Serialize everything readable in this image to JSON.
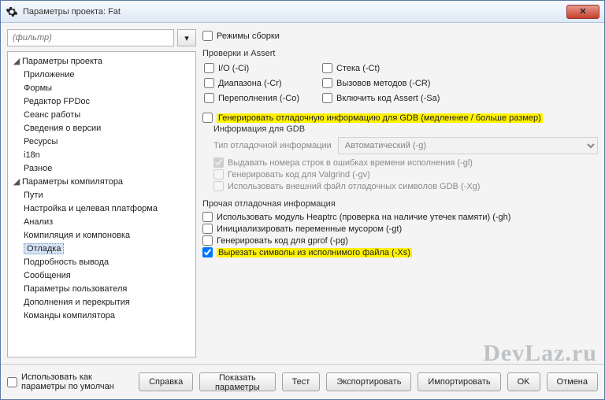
{
  "window": {
    "title": "Параметры проекта: Fat",
    "close": "✕"
  },
  "filter": {
    "placeholder": "(фильтр)"
  },
  "tree": {
    "root1": "Параметры проекта",
    "r1": [
      "Приложение",
      "Формы",
      "Редактор FPDoc",
      "Сеанс работы",
      "Сведения о версии",
      "Ресурсы",
      "i18n",
      "Разное"
    ],
    "root2": "Параметры компилятора",
    "r2": [
      "Пути",
      "Настройка и целевая платформа",
      "Анализ",
      "Компиляция и компоновка",
      "Отладка",
      "Подробность вывода",
      "Сообщения",
      "Параметры пользователя",
      "Дополнения и перекрытия",
      "Команды компилятора"
    ],
    "selected": "Отладка"
  },
  "right": {
    "buildModes": "Режимы сборки",
    "checksHdr": "Проверки и Assert",
    "checks": {
      "io": "I/O (-Ci)",
      "stack": "Стека (-Ct)",
      "range": "Диапазона (-Cr)",
      "method": "Вызовов методов (-CR)",
      "overflow": "Переполнения (-Co)",
      "assert": "Включить код Assert (-Sa)"
    },
    "genDbg": "Генерировать отладочную информацию для GDB (медленнее / больше размер)",
    "gdbHdr": "Информация для GDB",
    "dbgTypeLabel": "Тип отладочной информации",
    "dbgTypeValue": "Автоматический (-g)",
    "gdb": {
      "lines": "Выдавать номера строк в ошибках времени исполнения (-gl)",
      "valgrind": "Генерировать код для Valgrind (-gv)",
      "extsym": "Использовать внешний файл отладочных символов GDB (-Xg)"
    },
    "otherHdr": "Прочая отладочная информация",
    "other": {
      "heaptrc": "Использовать модуль Heaptrc (проверка на наличие утечек памяти) (-gh)",
      "trash": "Инициализировать переменные мусором (-gt)",
      "gprof": "Генерировать код для gprof (-pg)",
      "strip": "Вырезать символы из исполнимого файла (-Xs)"
    }
  },
  "footer": {
    "useDefault": "Использовать как параметры по умолчан",
    "help": "Справка",
    "show": "Показать параметры",
    "test": "Тест",
    "export": "Экспортировать",
    "import": "Импортировать",
    "ok": "OK",
    "cancel": "Отмена"
  },
  "watermark": "DevLaz.ru"
}
